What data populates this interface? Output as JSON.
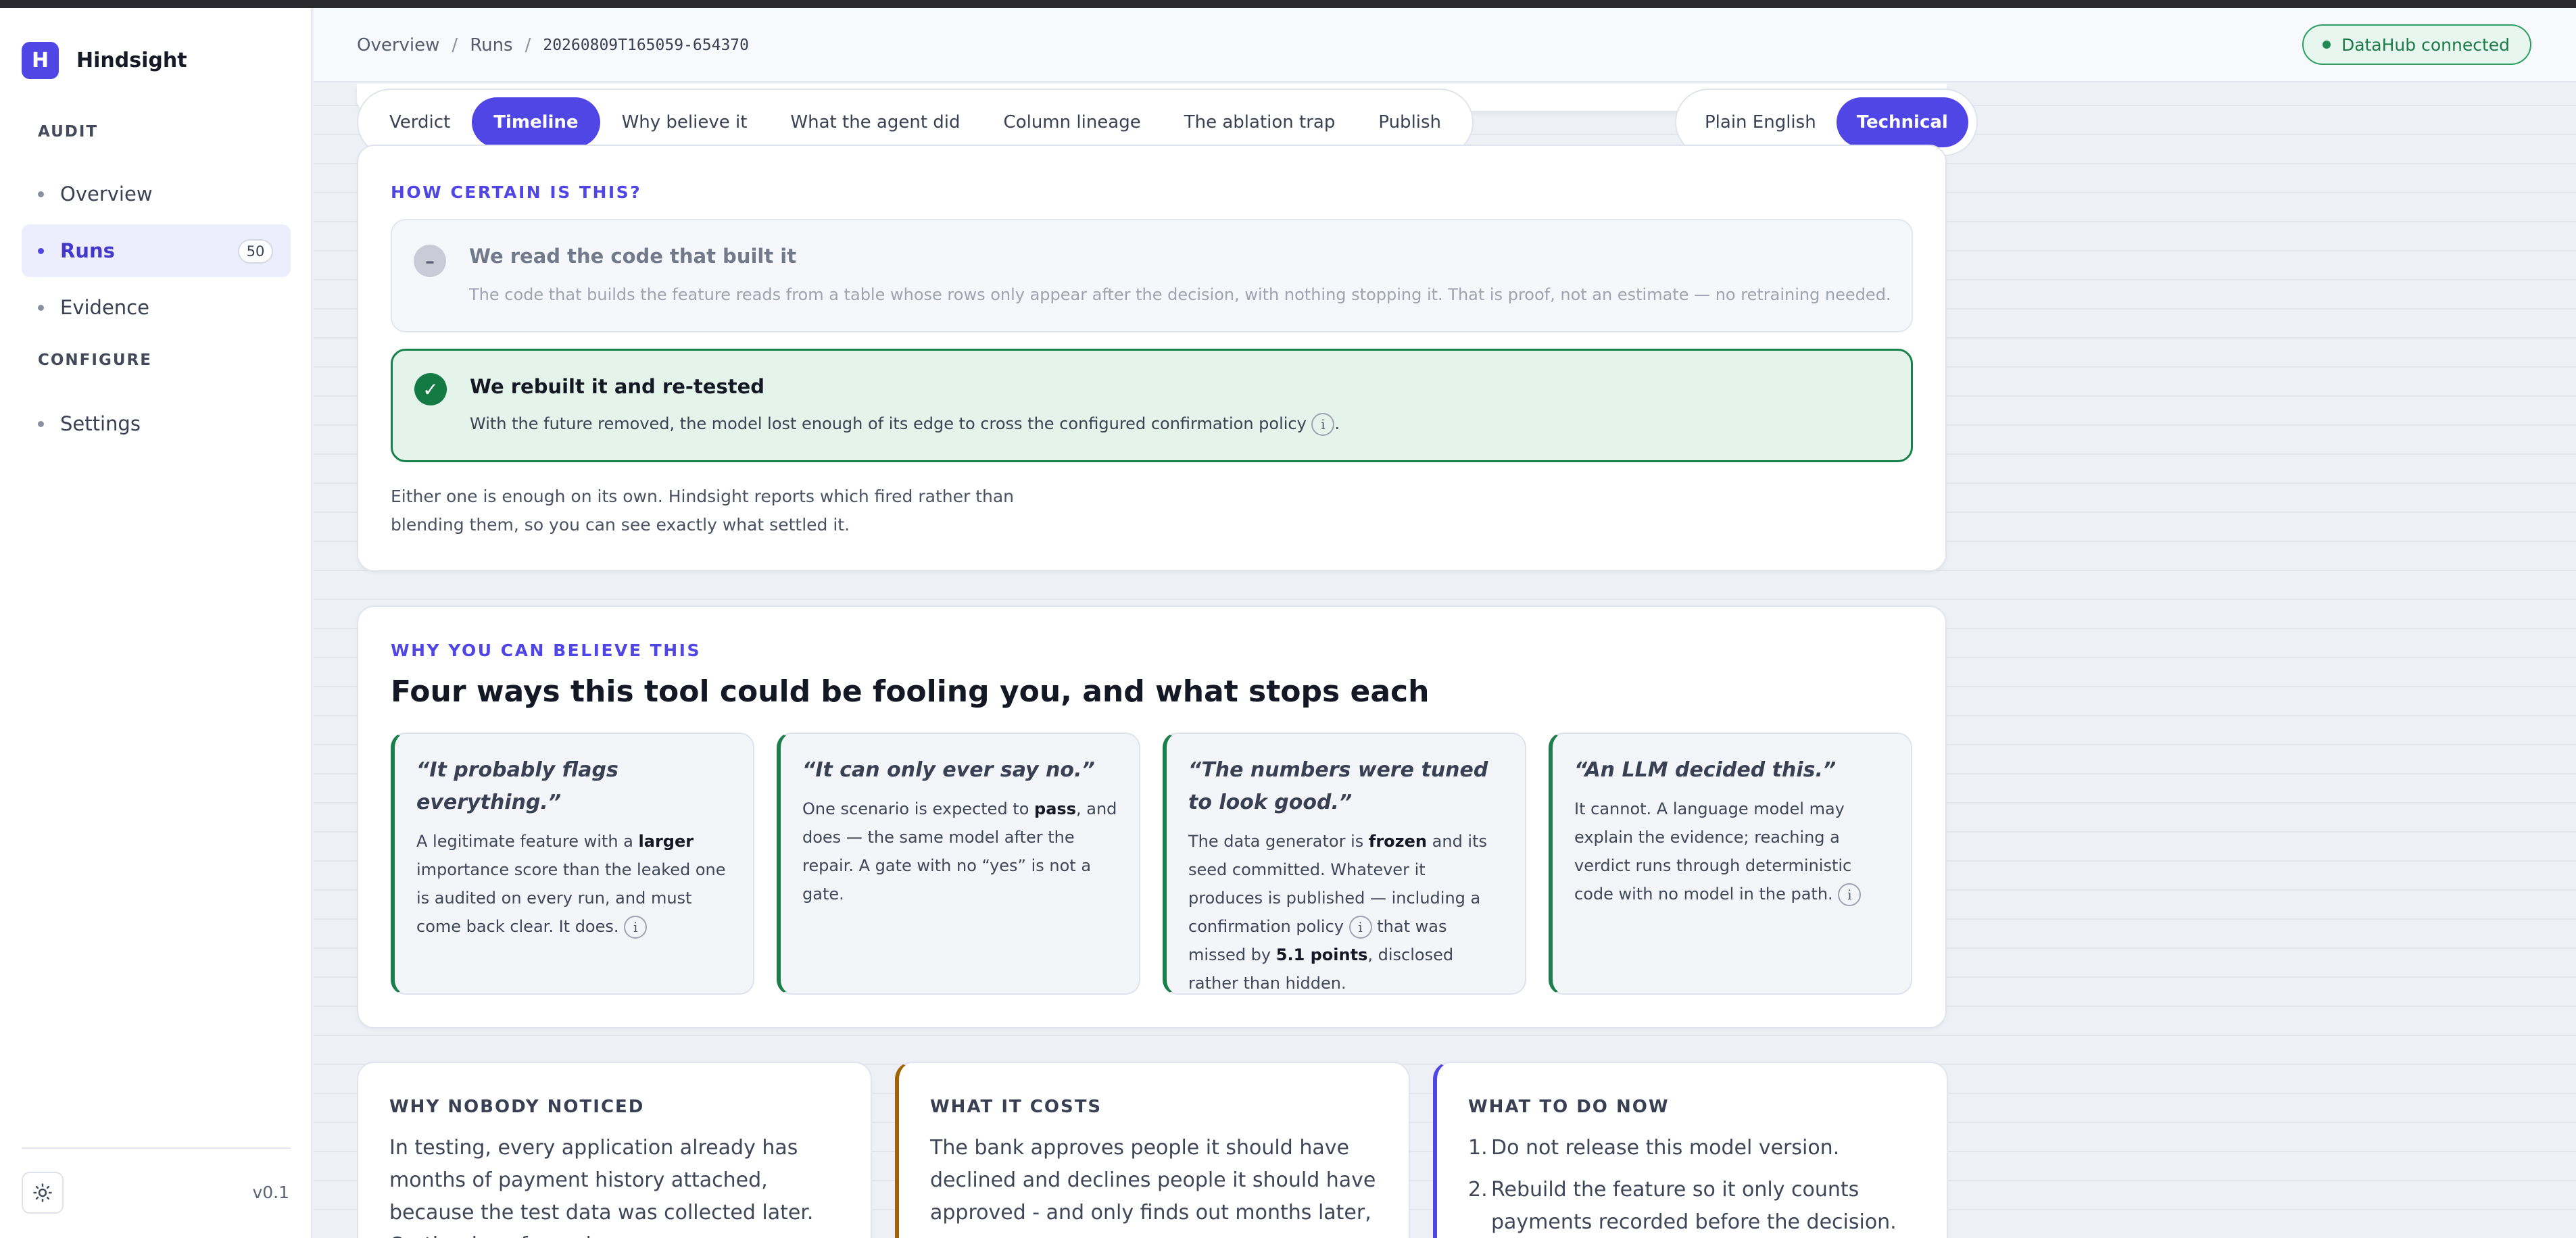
{
  "app": {
    "logo_letter": "H",
    "name": "Hindsight",
    "version": "v0.1",
    "accent_color": "#4f46e5"
  },
  "sidebar": {
    "sections": [
      {
        "title": "AUDIT",
        "items": [
          {
            "label": "Overview",
            "active": false
          },
          {
            "label": "Runs",
            "active": true,
            "count": "50"
          },
          {
            "label": "Evidence",
            "active": false
          }
        ]
      },
      {
        "title": "CONFIGURE",
        "items": [
          {
            "label": "Settings",
            "active": false
          }
        ]
      }
    ],
    "theme_icon": "sun-icon"
  },
  "header": {
    "breadcrumbs": [
      "Overview",
      "Runs",
      "20260809T165059-654370"
    ],
    "separator": "/",
    "connection": {
      "label": "DataHub connected",
      "color": "#1f8a52"
    }
  },
  "tabs": {
    "items": [
      "Verdict",
      "Timeline",
      "Why believe it",
      "What the agent did",
      "Column lineage",
      "The ablation trap",
      "Publish"
    ],
    "active": "Timeline"
  },
  "mode_toggle": {
    "items": [
      "Plain English",
      "Technical"
    ],
    "active": "Technical"
  },
  "certainty": {
    "eyebrow": "HOW CERTAIN IS THIS?",
    "rows": [
      {
        "state": "not-fired",
        "icon": "dash-icon",
        "title": "We read the code that built it",
        "desc": "The code that builds the feature reads from a table whose rows only appear after the decision, with nothing stopping it. That is proof, not an estimate — no retraining needed."
      },
      {
        "state": "fired",
        "icon": "check-icon",
        "title": "We rebuilt it and re-tested",
        "desc": "With the future removed, the model lost enough of its edge to cross the configured confirmation policy"
      }
    ],
    "footnote": "Either one is enough on its own. Hindsight reports which fired rather than blending them, so you can see exactly what settled it."
  },
  "believe": {
    "eyebrow": "WHY YOU CAN BELIEVE THIS",
    "title": "Four ways this tool could be fooling you, and what stops each",
    "cards": [
      {
        "quote": "“It probably flags everything.”",
        "p1": "A legitimate feature with a ",
        "b1": "larger",
        "p2": " importance score than the leaked one is audited on every run, and must come back clear. It does.",
        "b2": "",
        "p3": "",
        "info": true
      },
      {
        "quote": "“It can only ever say no.”",
        "p1": "One scenario is expected to ",
        "b1": "pass",
        "p2": ", and does — the same model after the repair. A gate with no “yes” is not a gate.",
        "b2": "",
        "p3": "",
        "info": false
      },
      {
        "quote": "“The numbers were tuned to look good.”",
        "p1": "The data generator is ",
        "b1": "frozen",
        "p2": " and its seed committed. Whatever it produces is published — including a confirmation policy ",
        "p2b": " that was missed by ",
        "b2": "5.1 points",
        "p3": ", disclosed rather than hidden.",
        "info": false
      },
      {
        "quote": "“An LLM decided this.”",
        "p1": "It cannot. A language model may explain the evidence; reaching a verdict runs through deterministic code with no model in the path.",
        "b1": "",
        "p2": "",
        "b2": "",
        "p3": "",
        "info": true
      }
    ]
  },
  "bottom": {
    "why": {
      "title": "WHY NOBODY NOTICED",
      "body": "In testing, every application already has months of payment history attached, because the test data was collected later. On the day of a real"
    },
    "cost": {
      "title": "WHAT IT COSTS",
      "body": "The bank approves people it should have declined and declines people it should have approved - and only finds out months later, one"
    },
    "todo": {
      "title": "WHAT TO DO NOW",
      "items": [
        "Do not release this model version.",
        "Rebuild the feature so it only counts payments recorded before the decision."
      ]
    }
  }
}
